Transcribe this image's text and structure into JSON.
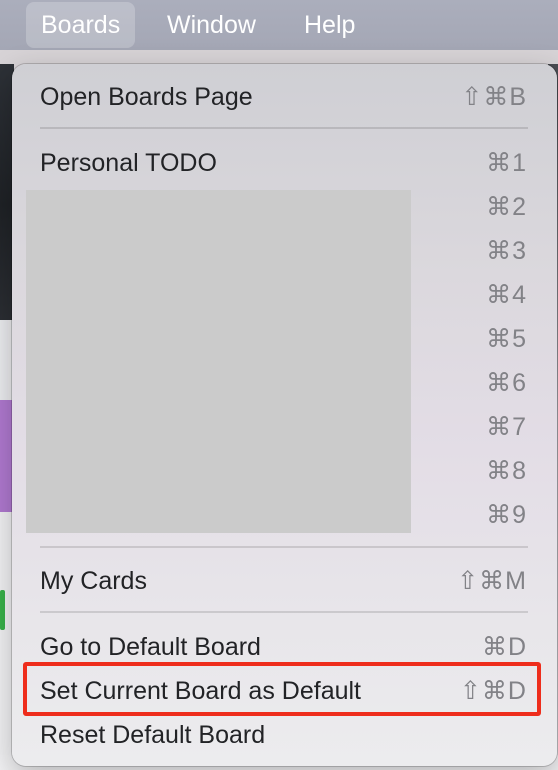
{
  "menubar": {
    "items": [
      {
        "label": "Boards",
        "active": true
      },
      {
        "label": "Window",
        "active": false
      },
      {
        "label": "Help",
        "active": false
      }
    ]
  },
  "boards_menu": {
    "open_boards_page": {
      "label": "Open Boards Page",
      "shortcut": "⇧⌘B"
    },
    "personal_todo": {
      "label": "Personal TODO",
      "shortcut": "⌘1"
    },
    "board_shortcuts": [
      "⌘2",
      "⌘3",
      "⌘4",
      "⌘5",
      "⌘6",
      "⌘7",
      "⌘8",
      "⌘9"
    ],
    "my_cards": {
      "label": "My Cards",
      "shortcut": "⇧⌘M"
    },
    "go_to_default_board": {
      "label": "Go to Default Board",
      "shortcut": "⌘D"
    },
    "set_current_board_as_default": {
      "label": "Set Current Board as Default",
      "shortcut": "⇧⌘D",
      "highlighted": true
    },
    "reset_default_board": {
      "label": "Reset Default Board"
    }
  },
  "colors": {
    "highlight_border": "#ee2d1c",
    "menubar": "#a8abb9",
    "menu_text": "#222326",
    "shortcut_text": "#828287"
  }
}
